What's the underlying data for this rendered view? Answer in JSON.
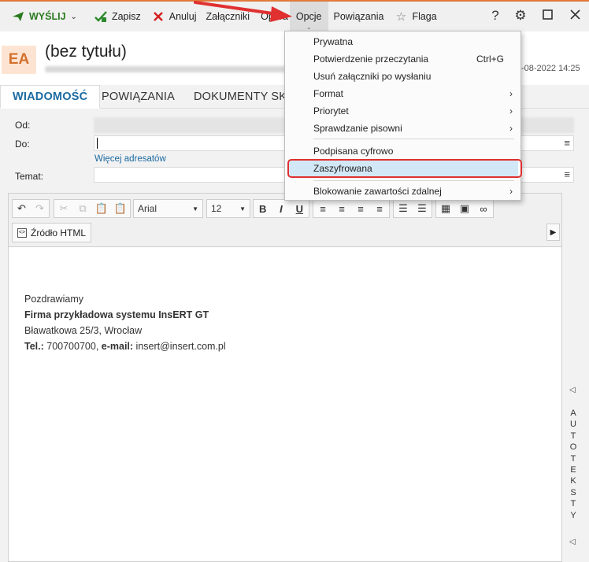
{
  "toolbar": {
    "send": "WYŚLIJ",
    "save": "Zapisz",
    "cancel": "Anuluj",
    "attachments": "Załączniki",
    "operations": "Opera",
    "options": "Opcje",
    "relations": "Powiązania",
    "flag": "Flaga",
    "help": "?"
  },
  "header": {
    "avatar": "EA",
    "title": "(bez tytułu)",
    "date": "-08-2022 14:25"
  },
  "tabs": [
    {
      "label": "WIADOMOŚĆ"
    },
    {
      "label": "POWIĄZANIA"
    },
    {
      "label": "DOKUMENTY SKO"
    }
  ],
  "form": {
    "from_label": "Od:",
    "to_label": "Do:",
    "more_recipients": "Więcej adresatów",
    "subject_label": "Temat:"
  },
  "editor": {
    "font": "Arial",
    "size": "12",
    "bold": "B",
    "italic": "I",
    "underline": "U",
    "html_source": "Źródło HTML",
    "body": {
      "line1": "Pozdrawiamy",
      "line2": "Firma przykładowa systemu InsERT GT",
      "line3": "Bławatkowa 25/3, Wrocław",
      "tel_label": "Tel.:",
      "tel_value": " 700700700, ",
      "email_label": "e-mail:",
      "email_value": " insert@insert.com.pl"
    }
  },
  "side": {
    "letters": [
      "A",
      "U",
      "T",
      "O",
      "T",
      "E",
      "K",
      "S",
      "T",
      "Y"
    ]
  },
  "menu": {
    "items": [
      {
        "label": "Prywatna"
      },
      {
        "label": "Potwierdzenie przeczytania",
        "shortcut": "Ctrl+G"
      },
      {
        "label": "Usuń załączniki po wysłaniu"
      },
      {
        "label": "Format"
      },
      {
        "label": "Priorytet"
      },
      {
        "label": "Sprawdzanie pisowni"
      },
      {
        "label": "Podpisana cyfrowo"
      },
      {
        "label": "Zaszyfrowana"
      },
      {
        "label": "Blokowanie zawartości zdalnej"
      }
    ]
  },
  "colors": {
    "accent": "#e07a3a",
    "link": "#1a6aa0",
    "highlight": "#d3e8f6",
    "annotation": "#e03030"
  }
}
